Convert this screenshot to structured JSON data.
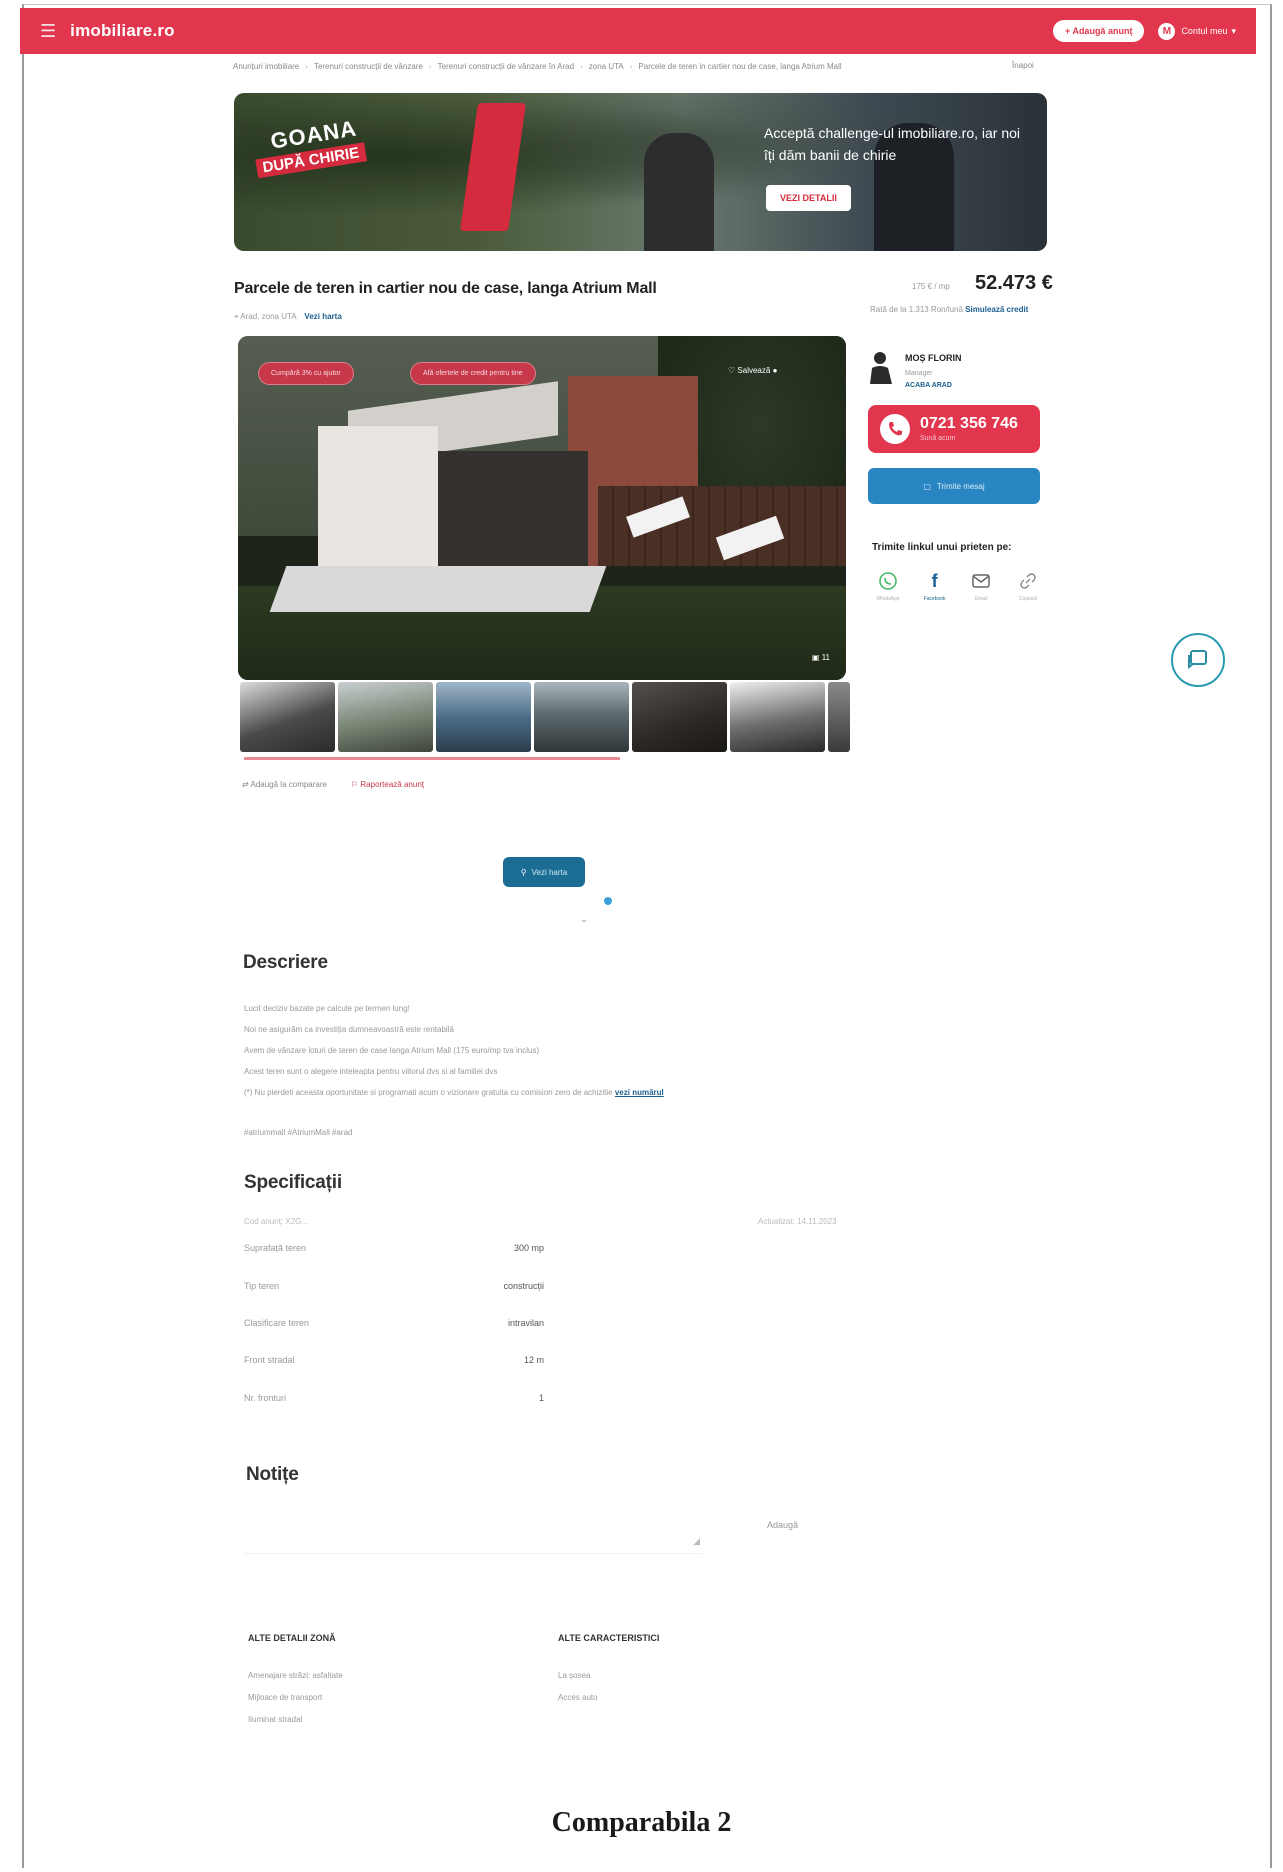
{
  "header": {
    "logo": "imobiliare.ro",
    "add_button": "+ Adaugă anunț",
    "user_initial": "M",
    "user_label": "Contul meu"
  },
  "breadcrumb": [
    "Anunțuri imobiliare",
    "Terenuri construcții de vânzare",
    "Terenuri construcții de vânzare în Arad",
    "zona UTA",
    "Parcele de teren in cartier nou de case, langa Atrium Mall"
  ],
  "back_label": "Înapoi",
  "banner": {
    "title_top": "GOANA",
    "title_bottom": "DUPĂ CHIRIE",
    "tagline": "Acceptă challenge-ul imobiliare.ro, iar noi îți dăm banii de chirie",
    "button": "VEZI DETALII"
  },
  "listing": {
    "title": "Parcele de teren in cartier nou de case, langa Atrium Mall",
    "location": "Arad, zona UTA",
    "map_link": "Vezi harta",
    "price_per_sqm": "175 € / mp",
    "price": "52.473 €",
    "installment_text": "Rată de la 1.313 Ron/lună",
    "installment_link": "Simulează credit"
  },
  "gallery": {
    "pill_1": "Cumpără 3% cu ajutor",
    "pill_2": "Afă ofertele de credit pentru tine",
    "save_label": "Salvează",
    "counter": "11"
  },
  "actions": {
    "compare": "Adaugă la comparare",
    "report": "Raportează anunț"
  },
  "agent": {
    "name": "MOȘ FLORIN",
    "role": "Manager",
    "company": "ACABA ARAD",
    "phone": "0721 356 746",
    "phone_sub": "Sună acum",
    "message_button": "Trimite mesaj",
    "share_title": "Trimite linkul unui prieten pe:",
    "share": [
      {
        "icon": "whatsapp-icon",
        "label": "WhatsApp"
      },
      {
        "icon": "facebook-icon",
        "label": "Facebook"
      },
      {
        "icon": "email-icon",
        "label": "Email"
      },
      {
        "icon": "link-icon",
        "label": "Copiază"
      }
    ]
  },
  "map_button": "Vezi harta",
  "description": {
    "title": "Descriere",
    "lines": [
      "Lucit deciziv bazate pe calcule pe termen lung!",
      "Noi ne asigurăm ca investiția dumneavoastră este rentabilă",
      "Avem de vânzare loturi de teren de case langa Atrium Mall (175 euro/mp tva inclus)",
      "Acest teren sunt o alegere inteleapta pentru viitorul dvs si al familiei dvs",
      "(*) Nu pierdeti aceasta oportunitate si programati acum o vizionare gratuita cu comision zero de achizitie"
    ],
    "more_link": "vezi numărul",
    "hashtags": "#atriummall #AtriumMall #arad"
  },
  "specs": {
    "title": "Specificații",
    "id_label": "Cod anunț: X2G...",
    "updated_label": "Actualizat: 14.11.2023",
    "rows": [
      {
        "key": "Suprafață teren",
        "value": "300 mp"
      },
      {
        "key": "Tip teren",
        "value": "construcții"
      },
      {
        "key": "Clasificare teren",
        "value": "intravilan"
      },
      {
        "key": "Front stradal",
        "value": "12 m"
      },
      {
        "key": "Nr. fronturi",
        "value": "1"
      }
    ]
  },
  "notes": {
    "title": "Notițe",
    "add": "Adaugă"
  },
  "zone": {
    "title": "ALTE DETALII ZONĂ",
    "items": [
      "Amenajare străzi: asfaltate",
      "Mijloace de transport",
      "Iluminat stradal"
    ]
  },
  "features": {
    "title": "ALTE CARACTERISTICI",
    "items": [
      "La șosea",
      "Acces auto"
    ]
  },
  "caption": "Comparabila 2"
}
